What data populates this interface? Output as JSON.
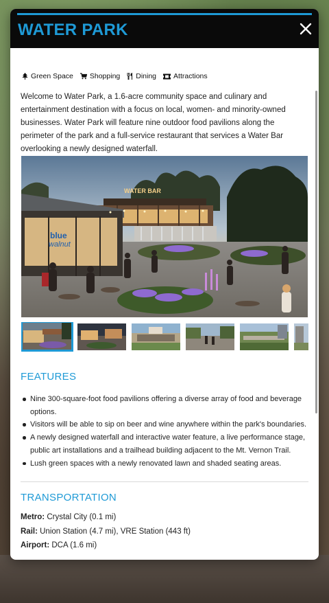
{
  "modal": {
    "title": "WATER PARK"
  },
  "categories": [
    {
      "label": "Green Space",
      "icon": "tree-icon"
    },
    {
      "label": "Shopping",
      "icon": "cart-icon"
    },
    {
      "label": "Dining",
      "icon": "utensils-icon"
    },
    {
      "label": "Attractions",
      "icon": "ticket-icon"
    }
  ],
  "intro": "Welcome to Water Park, a 1.6-acre community space and culinary and entertainment destination with a focus on local, women- and minority-owned businesses. Water Park will feature nine outdoor food pavilions along the perimeter of the park and a full-service restaurant that services a Water Bar overlooking a newly designed waterfall.",
  "gallery": {
    "main_signs": {
      "bar": "WATER BAR",
      "kiosk_line1": "blue",
      "kiosk_line2": "walnut"
    },
    "thumbnail_count": 6,
    "active_index": 0
  },
  "features": {
    "title": "FEATURES",
    "items": [
      "Nine 300-square-foot food pavilions offering a diverse array of food and beverage options.",
      "Visitors will be able to sip on beer and wine anywhere within the park's boundaries.",
      "A newly designed waterfall and interactive water feature, a live performance stage, public art installations and a trailhead building adjacent to the Mt. Vernon Trail.",
      "Lush green spaces with a newly renovated lawn and shaded seating areas."
    ]
  },
  "transportation": {
    "title": "TRANSPORTATION",
    "rows": [
      {
        "label": "Metro:",
        "value": "Crystal City (0.1 mi)"
      },
      {
        "label": "Rail:",
        "value": "Union Station (4.7 mi), VRE Station (443 ft)"
      },
      {
        "label": "Airport:",
        "value": "DCA (1.6 mi)"
      }
    ]
  },
  "colors": {
    "accent": "#1e9ad6",
    "header_bg": "#0a0a0a"
  }
}
